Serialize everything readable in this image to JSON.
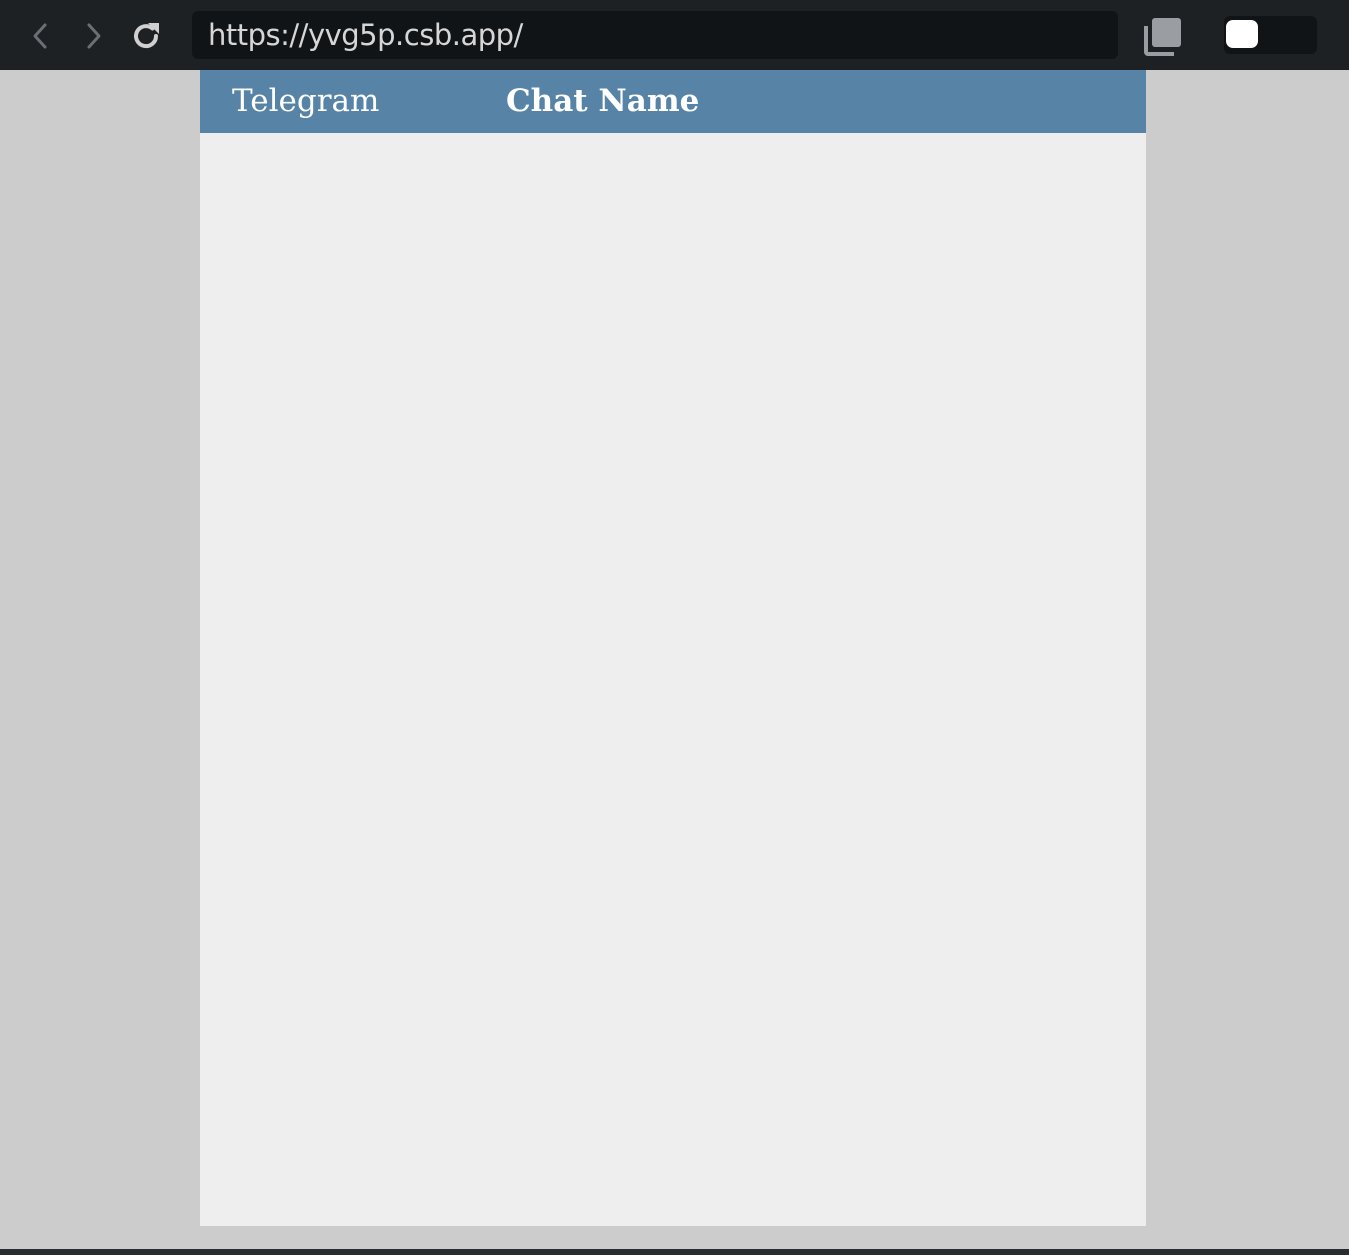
{
  "browser": {
    "url": "https://yvg5p.csb.app/",
    "icons": {
      "back": "chevron-left-icon",
      "forward": "chevron-right-icon",
      "reload": "reload-icon",
      "copy": "copy-icon"
    }
  },
  "app": {
    "brand": "Telegram",
    "chat_name": "Chat Name",
    "colors": {
      "header": "#5683a6",
      "body": "#eeeeee",
      "page": "#cccccc"
    }
  }
}
